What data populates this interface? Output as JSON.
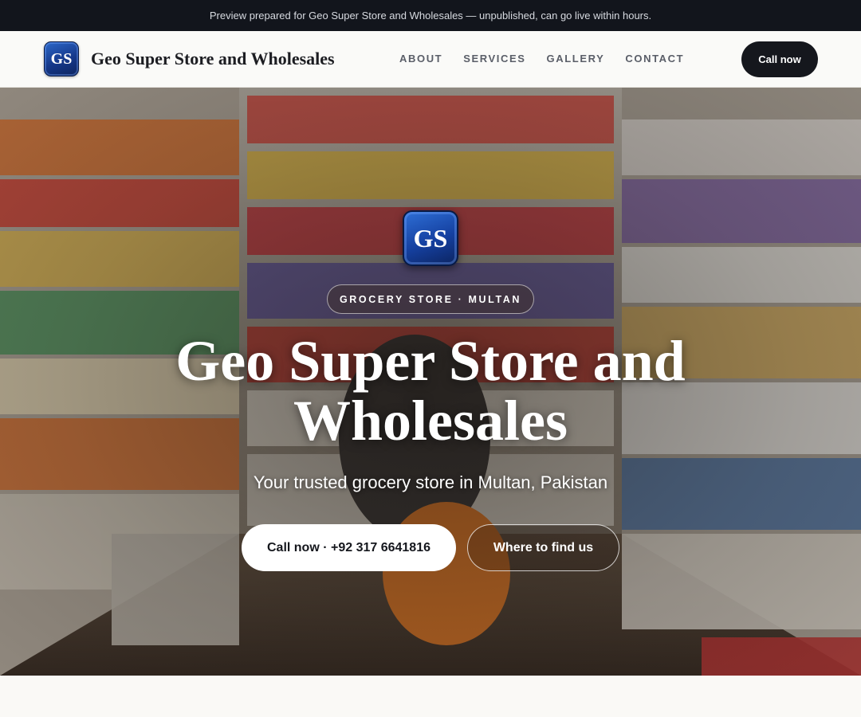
{
  "preview_banner": {
    "text": "Preview prepared for Geo Super Store and Wholesales — unpublished, can go live within hours."
  },
  "header": {
    "logo_initials": "GS",
    "brand_name": "Geo Super Store and Wholesales",
    "nav": [
      {
        "label": "ABOUT"
      },
      {
        "label": "SERVICES"
      },
      {
        "label": "GALLERY"
      },
      {
        "label": "CONTACT"
      }
    ],
    "cta_label": "Call now"
  },
  "hero": {
    "logo_initials": "GS",
    "tag": "GROCERY STORE · MULTAN",
    "title_line1": "Geo Super Store and",
    "title_line2": "Wholesales",
    "subtitle": "Your trusted grocery store in Multan, Pakistan",
    "primary_button": "Call now · +92 317 6641816",
    "secondary_button": "Where to find us",
    "background_image": "grocery-store-aisle-photo"
  },
  "colors": {
    "dark": "#12151c",
    "brand_blue": "#1540a0",
    "page_bg": "#faf9f6"
  }
}
